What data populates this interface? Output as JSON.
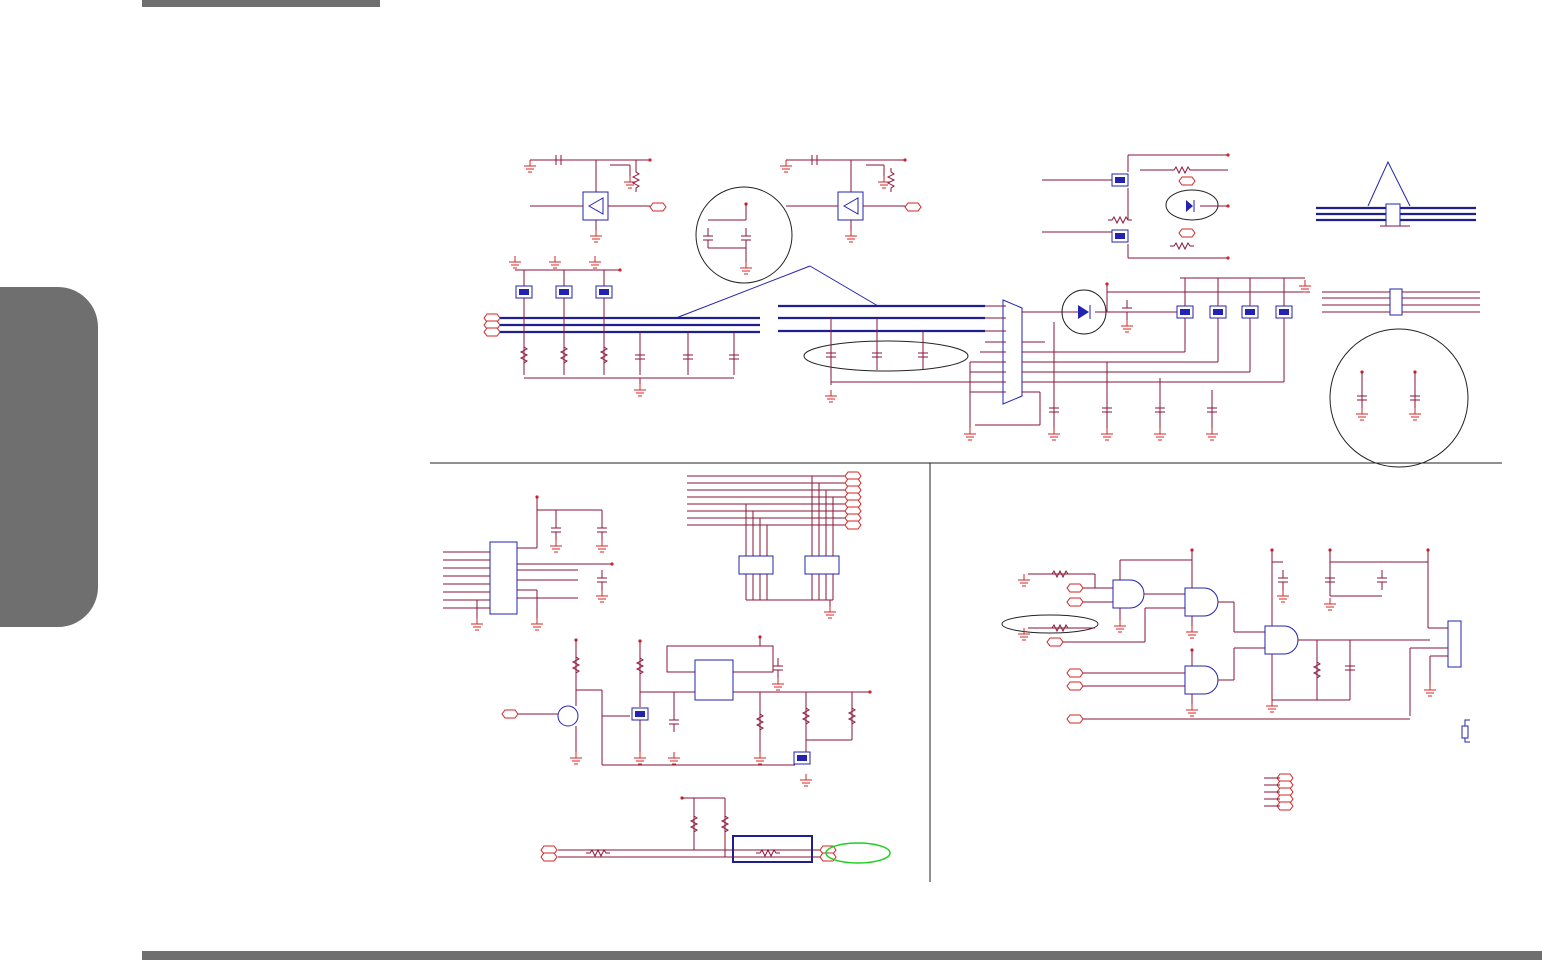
{
  "colors": {
    "wire": "#8a1538",
    "bus": "#1f1f8f",
    "component": "#2323b0",
    "ground_and_ports": "#d42424",
    "highlight": "#20d020",
    "chrome": "#6f6f6f"
  }
}
